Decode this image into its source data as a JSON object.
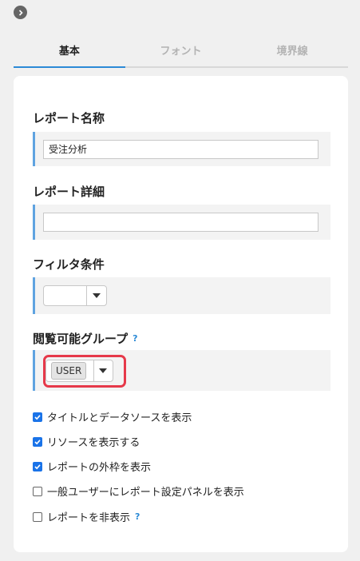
{
  "tabs": [
    "基本",
    "フォント",
    "境界線"
  ],
  "fields": {
    "report_name": {
      "label": "レポート名称",
      "value": "受注分析"
    },
    "report_detail": {
      "label": "レポート詳細",
      "value": ""
    },
    "filter": {
      "label": "フィルタ条件",
      "value": ""
    },
    "group": {
      "label": "閲覧可能グループ",
      "help": "?",
      "chip": "USER"
    }
  },
  "options": [
    {
      "label": "タイトルとデータソースを表示",
      "checked": true
    },
    {
      "label": "リソースを表示する",
      "checked": true
    },
    {
      "label": "レポートの外枠を表示",
      "checked": true
    },
    {
      "label": "一般ユーザーにレポート設定パネルを表示",
      "checked": false
    },
    {
      "label": "レポートを非表示",
      "checked": false,
      "help": "?"
    }
  ],
  "colors": {
    "accent": "#2b8ad6",
    "checkbox": "#1a73e8",
    "highlight": "#e6394a"
  }
}
